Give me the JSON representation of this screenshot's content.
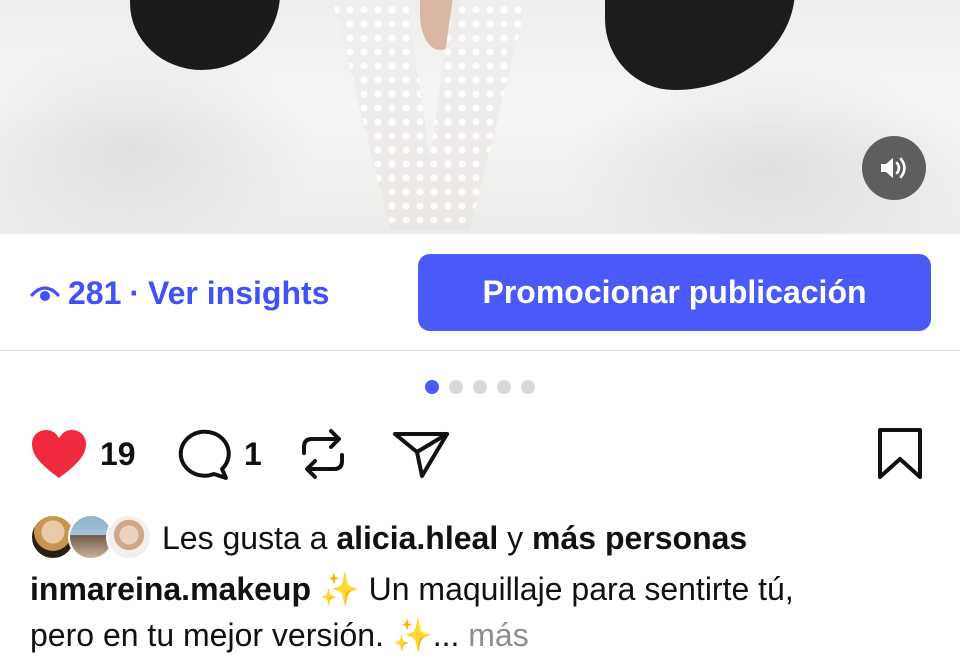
{
  "media": {
    "sound_icon": "speaker-on-icon"
  },
  "insights": {
    "eye_icon": "eye-icon",
    "views": "281",
    "separator": "·",
    "link_label": "Ver insights"
  },
  "promote": {
    "label": "Promocionar publicación"
  },
  "carousel": {
    "count": 5,
    "active": 0
  },
  "actions": {
    "likes": "19",
    "comments": "1",
    "like_icon": "heart-filled-icon",
    "comment_icon": "comment-bubble-icon",
    "repost_icon": "repost-icon",
    "share_icon": "send-icon",
    "save_icon": "bookmark-icon"
  },
  "liked_by": {
    "prefix": "Les gusta a",
    "user": "alicia.hleal",
    "connector": "y",
    "suffix": "más personas"
  },
  "caption": {
    "username": "inmareina.makeup",
    "emoji1": "✨",
    "text_line1": "Un maquillaje para sentirte tú,",
    "text_line2": "pero en tu mejor versión.",
    "emoji2": "✨",
    "ellipsis": "...",
    "more": "más"
  },
  "colors": {
    "accent": "#4a5af8",
    "like": "#ee2a3c",
    "muted": "#8e8e8e"
  }
}
